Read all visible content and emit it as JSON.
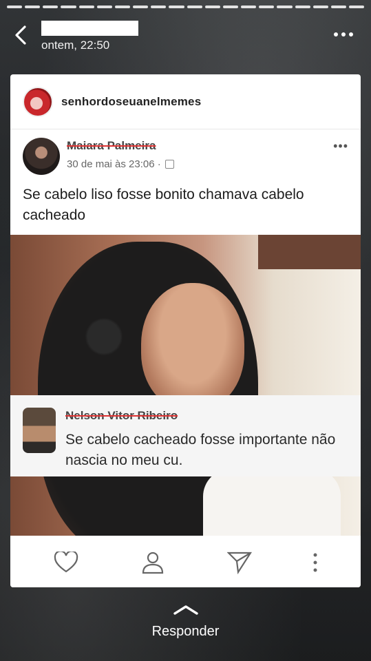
{
  "story": {
    "time": "ontem, 22:50",
    "progress_segments": 20
  },
  "card": {
    "account_username": "senhordoseuanelmemes",
    "facebook_post": {
      "author": "Maiara Palmeira",
      "meta": "30 de mai às 23:06 ·",
      "options": "•••",
      "text": "Se cabelo liso fosse bonito chamava cabelo cacheado"
    },
    "comment": {
      "author": "Nelson Vitor Ribeiro",
      "text": "Se cabelo cacheado fosse importante não nascia no meu cu."
    }
  },
  "footer": {
    "reply_label": "Responder"
  },
  "icons": {
    "back": "chevron-left-icon",
    "more": "more-horizontal-icon",
    "like": "heart-icon",
    "profile": "user-icon",
    "share": "send-icon",
    "menu": "more-vertical-icon",
    "reply": "chevron-up-icon"
  }
}
